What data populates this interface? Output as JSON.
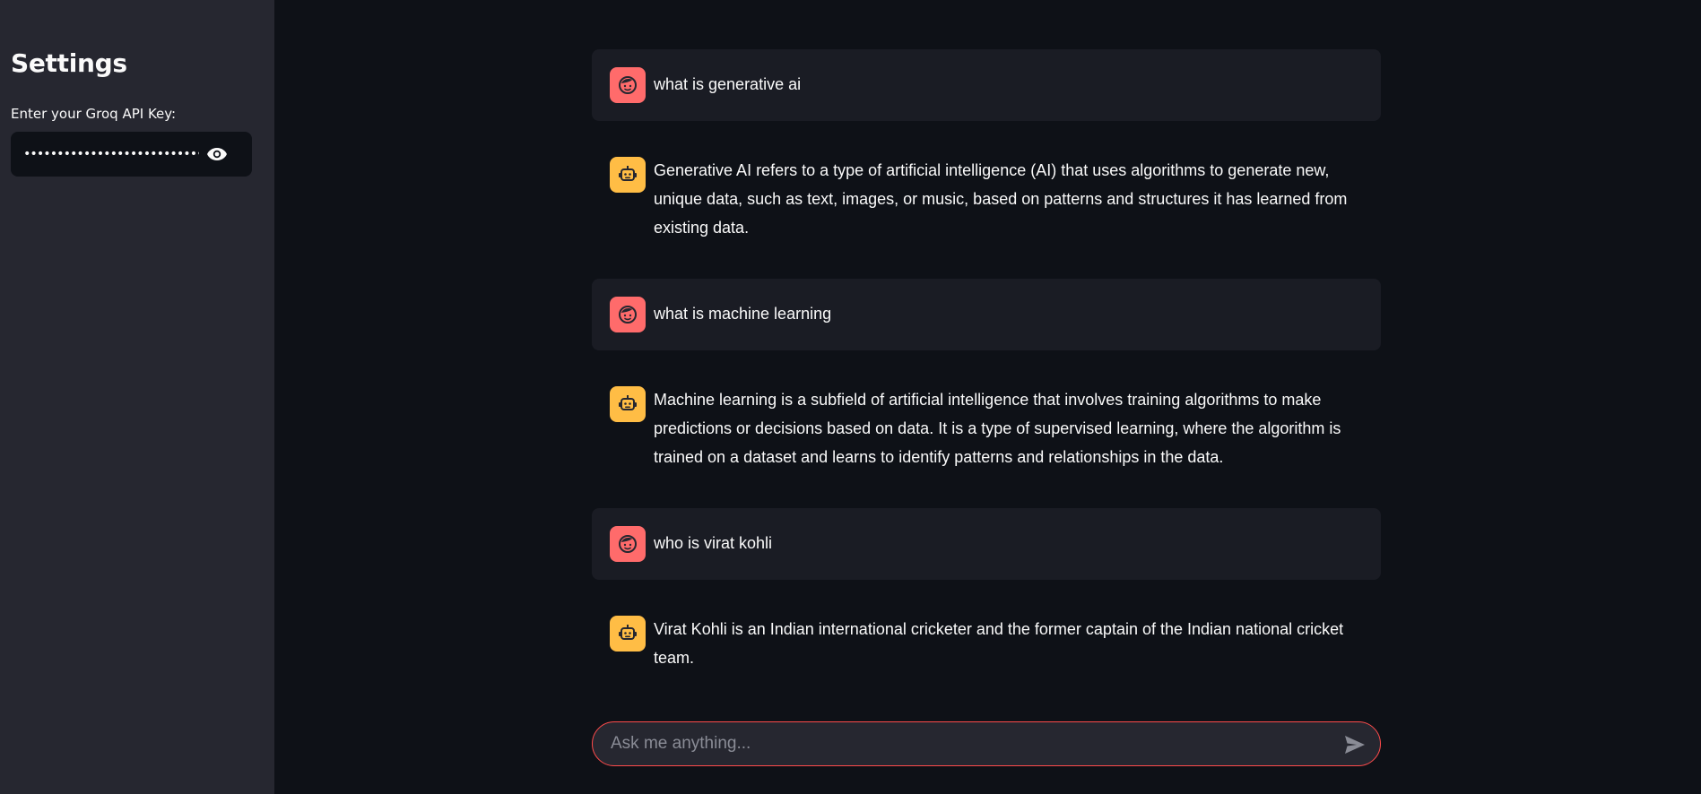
{
  "sidebar": {
    "title": "Settings",
    "api_key_label": "Enter your Groq API Key:",
    "api_key_masked": "••••••••••••••••••••••••••••••••••••••••••",
    "toggle_visibility_icon": "eye-icon"
  },
  "chat": {
    "messages": [
      {
        "role": "user",
        "avatar_icon": "user-face-icon",
        "text": "what is generative ai"
      },
      {
        "role": "assistant",
        "avatar_icon": "robot-icon",
        "text": "Generative AI refers to a type of artificial intelligence (AI) that uses algorithms to generate new, unique data, such as text, images, or music, based on patterns and structures it has learned from existing data."
      },
      {
        "role": "user",
        "avatar_icon": "user-face-icon",
        "text": "what is machine learning"
      },
      {
        "role": "assistant",
        "avatar_icon": "robot-icon",
        "text": "Machine learning is a subfield of artificial intelligence that involves training algorithms to make predictions or decisions based on data. It is a type of supervised learning, where the algorithm is trained on a dataset and learns to identify patterns and relationships in the data."
      },
      {
        "role": "user",
        "avatar_icon": "user-face-icon",
        "text": "who is virat kohli"
      },
      {
        "role": "assistant",
        "avatar_icon": "robot-icon",
        "text": "Virat Kohli is an Indian international cricketer and the former captain of the Indian national cricket team."
      }
    ],
    "input_placeholder": "Ask me anything...",
    "input_value": "",
    "send_icon": "send-icon"
  },
  "colors": {
    "background": "#0e1117",
    "sidebar": "#262730",
    "user_avatar": "#ff6b6b",
    "assistant_avatar": "#ffbd45",
    "input_border": "#ff4b4b"
  }
}
